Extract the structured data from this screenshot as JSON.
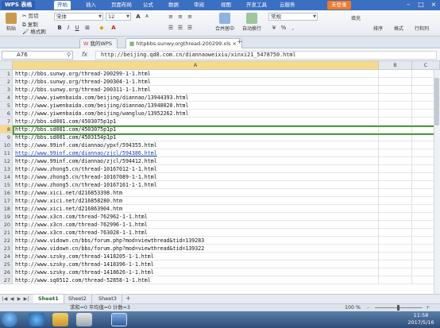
{
  "app": {
    "name": "WPS 表格",
    "login": "未登录"
  },
  "menu": [
    "开始",
    "插入",
    "页面布局",
    "公式",
    "数据",
    "审阅",
    "视图",
    "开发工具",
    "云服务"
  ],
  "ribbon": {
    "paste": "粘贴",
    "cut": "剪切",
    "copy": "复制",
    "format_painter": "格式刷",
    "font_name": "宋体",
    "font_size": "12",
    "merge_center": "合并居中",
    "wrap": "自动换行",
    "number_format": "常规",
    "fill": "填充",
    "sort": "排序",
    "format": "格式",
    "rows_cols": "行和列"
  },
  "doc_tabs": [
    "我的WPS",
    "httpbbs.sunwy.orgthread-200299.xls"
  ],
  "formula_bar": {
    "name_box": "A76",
    "fx": "fx",
    "content": "http://beijing.qd8.com.cn/diannaoweixiu/xinxi21_5478750.html"
  },
  "columns": [
    "A",
    "B",
    "C"
  ],
  "rows": [
    {
      "n": "1",
      "a": "http://bbs.sunwy.org/thread-200299-1-1.html",
      "link": false
    },
    {
      "n": "2",
      "a": "http://bbs.sunwy.org/thread-200304-1-1.html",
      "link": false
    },
    {
      "n": "3",
      "a": "http://bbs.sunwy.org/thread-200311-1-1.html",
      "link": false
    },
    {
      "n": "4",
      "a": "http://www.yiwenbaida.com/beijing/diannao/13944393.html",
      "link": false
    },
    {
      "n": "5",
      "a": "http://www.yiwenbaida.com/beijing/diannao/13948020.html",
      "link": false
    },
    {
      "n": "6",
      "a": "http://www.yiwenbaida.com/beijing/wangluo/13952262.html",
      "link": false
    },
    {
      "n": "7",
      "a": "http://bbs.sd001.com/4503075p1p1",
      "link": false
    },
    {
      "n": "8",
      "a": "http://bbs.sd001.com/4503075p1p1",
      "link": false
    },
    {
      "n": "9",
      "a": "http://bbs.sd001.com/4503154p1p1",
      "link": false
    },
    {
      "n": "10",
      "a": "http://www.99inf.com/diannao/ypxf/594355.html",
      "link": false
    },
    {
      "n": "11",
      "a": "http://www.99inf.com/diannao/zjcl/594386.html",
      "link": true
    },
    {
      "n": "12",
      "a": "http://www.99inf.com/diannao/zjcl/594412.html",
      "link": false
    },
    {
      "n": "13",
      "a": "http://www.zhong5.cn/thread-10167012-1-1.html",
      "link": false
    },
    {
      "n": "14",
      "a": "http://www.zhong5.cn/thread-10167089-1-1.html",
      "link": false
    },
    {
      "n": "15",
      "a": "http://www.zhong5.cn/thread-10167161-1-1.html",
      "link": false
    },
    {
      "n": "16",
      "a": "http://www.xici.net/d216853398.htm",
      "link": false
    },
    {
      "n": "17",
      "a": "http://www.xici.net/d216858280.htm",
      "link": false
    },
    {
      "n": "18",
      "a": "http://www.xici.net/d216863904.htm",
      "link": false
    },
    {
      "n": "19",
      "a": "http://www.x3cn.com/thread-762962-1-1.html",
      "link": false
    },
    {
      "n": "20",
      "a": "http://www.x3cn.com/thread-762996-1-1.html",
      "link": false
    },
    {
      "n": "21",
      "a": "http://www.x3cn.com/thread-763028-1-1.html",
      "link": false
    },
    {
      "n": "22",
      "a": "http://www.vidown.cn/bbs/forum.php?mod=viewthread&tid=139283",
      "link": false
    },
    {
      "n": "23",
      "a": "http://www.vidown.cn/bbs/forum.php?mod=viewthread&tid=139322",
      "link": false
    },
    {
      "n": "24",
      "a": "http://www.szsky.com/thread-1418205-1-1.html",
      "link": false
    },
    {
      "n": "25",
      "a": "http://www.szsky.com/thread-1418396-1-1.html",
      "link": false
    },
    {
      "n": "26",
      "a": "http://www.szsky.com/thread-1418626-1-1.html",
      "link": false
    },
    {
      "n": "27",
      "a": "http://www.sq0512.com/thread-52858-1-1.html",
      "link": false
    }
  ],
  "sheets": [
    "Sheet1",
    "Sheet2",
    "Sheet3"
  ],
  "status": {
    "text": "求和=0  平均值=0  计数=3",
    "zoom": "100 %"
  },
  "clock": {
    "time": "11:58",
    "date": "2017/5/16"
  },
  "colors": {
    "accent": "#3b6fc2",
    "selection": "#4d9a3a",
    "link": "#1a3fb0"
  }
}
